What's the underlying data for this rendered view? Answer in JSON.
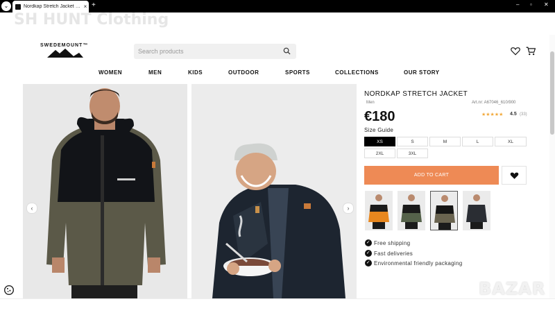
{
  "browser": {
    "tab_title": "Nordkap Stretch Jacket - Dani...",
    "tab_close": "×",
    "new_tab": "+",
    "menu_glyph": "⌄",
    "controls": {
      "minimize": "–",
      "maximize": "▫",
      "close": "✕"
    }
  },
  "watermark_top": "SH HUNT Clothing",
  "brand": {
    "logo_text": "SWEDEMOUNT™"
  },
  "search": {
    "placeholder": "Search products",
    "icon": "search-icon"
  },
  "header_icons": [
    "heart-icon",
    "cart-icon"
  ],
  "nav": {
    "items": [
      "WOMEN",
      "MEN",
      "KIDS",
      "OUTDOOR",
      "SPORTS",
      "COLLECTIONS",
      "OUR STORY"
    ]
  },
  "gallery": {
    "prev": "‹",
    "next": "›"
  },
  "product": {
    "name": "NORDKAP STRETCH JACKET",
    "category": "Men",
    "art_nr": "Art.nr: A67046_610/900",
    "price": "€180",
    "stars": "★★★★★",
    "rating": "4.5",
    "reviews": "(33)",
    "size_guide": "Size Guide",
    "sizes": [
      "XS",
      "S",
      "M",
      "L",
      "XL",
      "2XL",
      "3XL"
    ],
    "selected_size": "XS",
    "add_to_cart": "ADD TO CART",
    "wishlist_icon": "heart-icon"
  },
  "thumbnails": [
    {
      "name": "orange-black",
      "colors": [
        "#e8871e",
        "#1b1b1b"
      ]
    },
    {
      "name": "green-black",
      "colors": [
        "#55624a",
        "#1a1a1a"
      ]
    },
    {
      "name": "olive-black",
      "colors": [
        "#6a6450",
        "#151515"
      ]
    },
    {
      "name": "black",
      "colors": [
        "#2a2d33",
        "#1a1a1a"
      ]
    }
  ],
  "features": [
    "Free shipping",
    "Fast deliveries",
    "Environmental friendly packaging"
  ],
  "bottom_watermark": "BAZAR",
  "colors": {
    "accent": "#ee8a55",
    "dark": "#111111",
    "star": "#f2a93b"
  }
}
